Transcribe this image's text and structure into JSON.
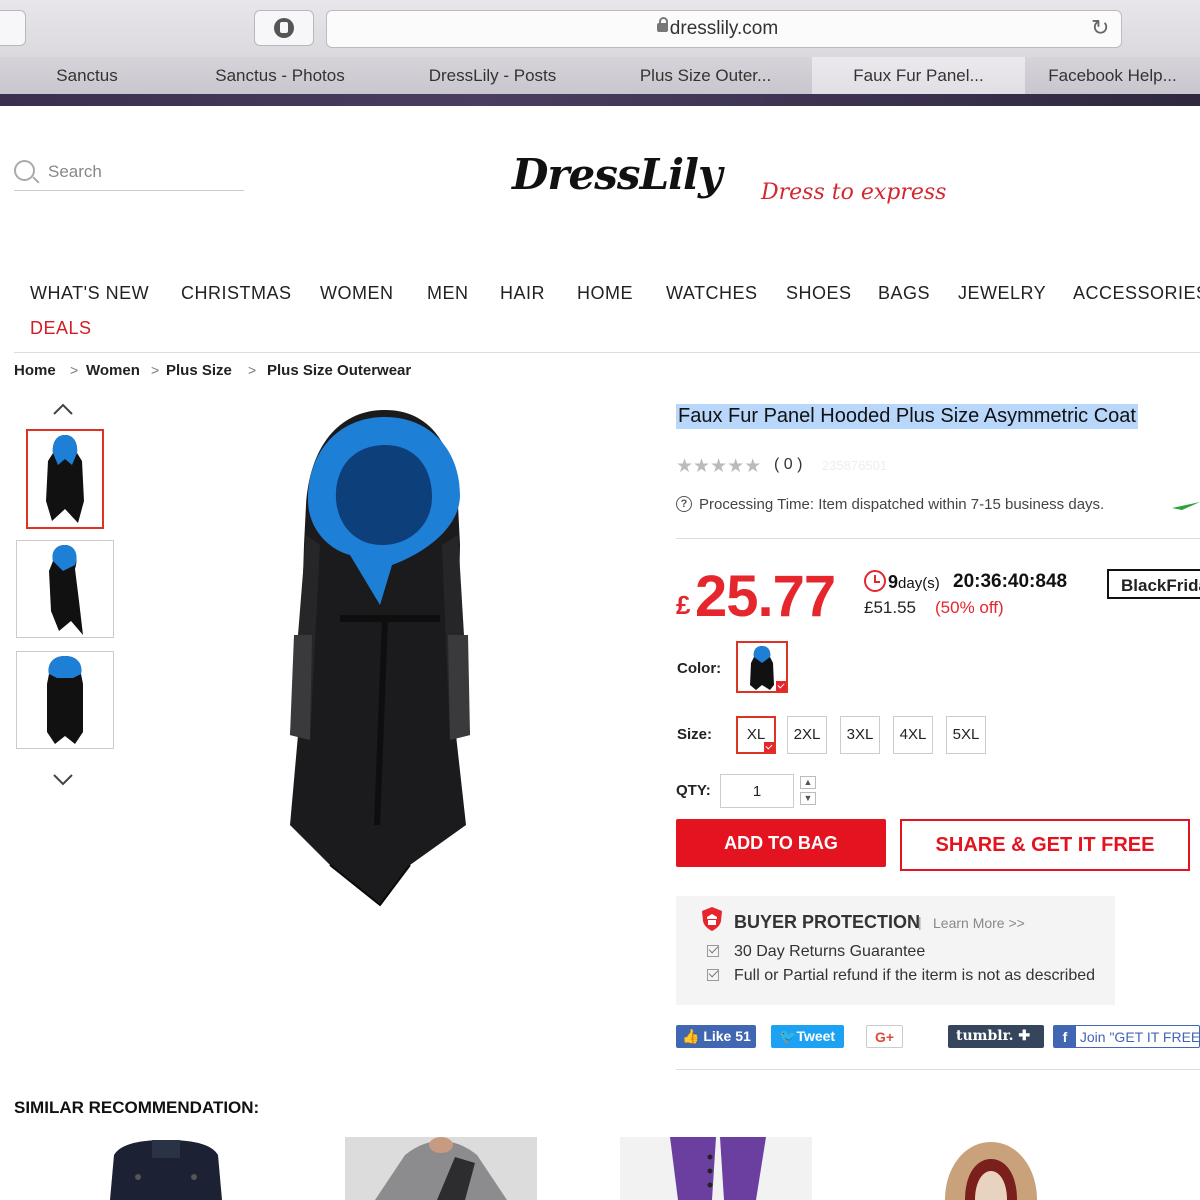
{
  "browser": {
    "url": "dresslily.com",
    "tabs": [
      {
        "label": "Sanctus"
      },
      {
        "label": "Sanctus - Photos"
      },
      {
        "label": "DressLily - Posts"
      },
      {
        "label": "Plus Size Outer..."
      },
      {
        "label": "Faux Fur Panel..."
      },
      {
        "label": "Facebook Help..."
      }
    ],
    "active_tab": 4
  },
  "header": {
    "search_placeholder": "Search",
    "logo": "DressLily",
    "tagline": "Dress to express"
  },
  "nav": {
    "items": [
      "WHAT'S NEW",
      "CHRISTMAS",
      "WOMEN",
      "MEN",
      "HAIR",
      "HOME",
      "WATCHES",
      "SHOES",
      "BAGS",
      "JEWELRY",
      "ACCESSORIES"
    ],
    "deals": "DEALS",
    "deals_color": "#d31c23"
  },
  "breadcrumb": [
    "Home",
    "Women",
    "Plus Size",
    "Plus Size Outerwear"
  ],
  "product": {
    "title": "Faux Fur Panel Hooded Plus Size Asymmetric Coat",
    "rating_stars": 0,
    "review_count": "( 0 )",
    "sku": "235876501",
    "processing": "Processing Time: Item dispatched within 7-15 business days.",
    "currency": "£",
    "price": "25.77",
    "countdown_days": "9",
    "countdown_days_unit": "day(s)",
    "countdown_time": "20:36:40:848",
    "original_price": "£51.55",
    "discount": "(50% off)",
    "promo_badge": "BlackFriday",
    "color_label": "Color:",
    "size_label": "Size:",
    "sizes": [
      "XL",
      "2XL",
      "3XL",
      "4XL",
      "5XL"
    ],
    "selected_size": "XL",
    "qty_label": "QTY:",
    "qty": "1",
    "add_to_bag": "ADD TO BAG",
    "share_free": "SHARE & GET IT FREE",
    "accent_color": "#e5262d",
    "fur_color": "#1e7fd6"
  },
  "protection": {
    "title": "BUYER PROTECTION",
    "separator": "|",
    "learn_more": "Learn More >>",
    "lines": [
      "30 Day Returns Guarantee",
      "Full or Partial refund if the iterm is not as described"
    ]
  },
  "social": {
    "like": "Like 51",
    "tweet": "Tweet",
    "gplus": "G+",
    "tumblr": "tumblr.",
    "facebook_join": "Join \"GET IT FREE\""
  },
  "similar": {
    "title": "SIMILAR RECOMMENDATION:"
  }
}
